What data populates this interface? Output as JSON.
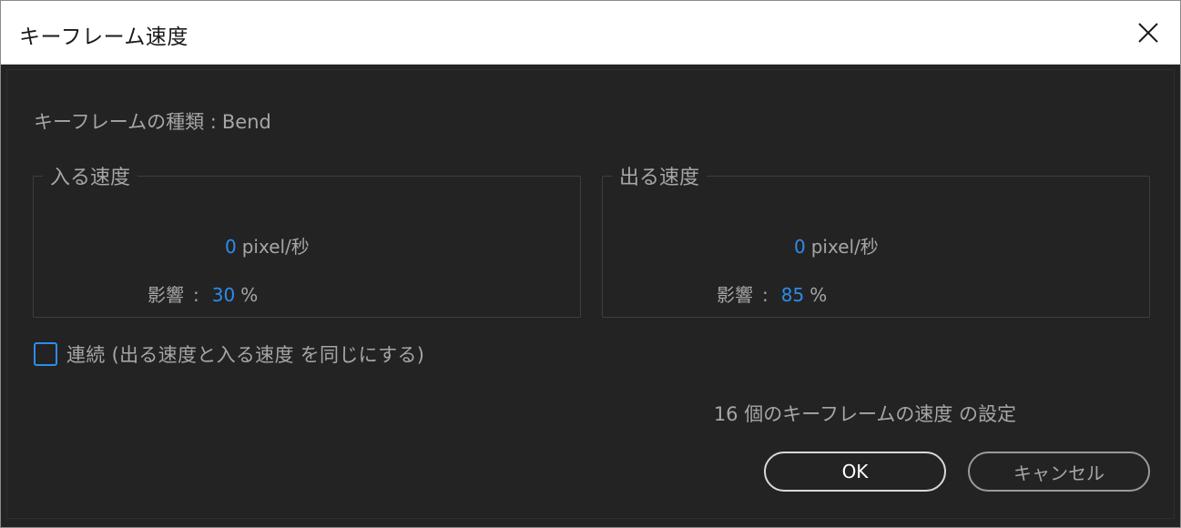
{
  "window": {
    "title": "キーフレーム速度"
  },
  "keyframe_type": {
    "label": "キーフレームの種類 :",
    "value": "Bend"
  },
  "incoming": {
    "legend": "入る速度",
    "speed_value": "0",
    "speed_unit": "pixel/秒",
    "influence_label": "影響",
    "influence_colon": ":",
    "influence_value": "30",
    "influence_unit": "%"
  },
  "outgoing": {
    "legend": "出る速度",
    "speed_value": "0",
    "speed_unit": "pixel/秒",
    "influence_label": "影響",
    "influence_colon": ":",
    "influence_value": "85",
    "influence_unit": "%"
  },
  "continuous": {
    "label": "連続 (出る速度と入る速度 を同じにする)",
    "checked": false
  },
  "summary": "16 個のキーフレームの速度 の設定",
  "buttons": {
    "ok": "OK",
    "cancel": "キャンセル"
  },
  "colors": {
    "accent": "#2d8ceb",
    "background": "#232323",
    "text": "#a6a6a6"
  }
}
